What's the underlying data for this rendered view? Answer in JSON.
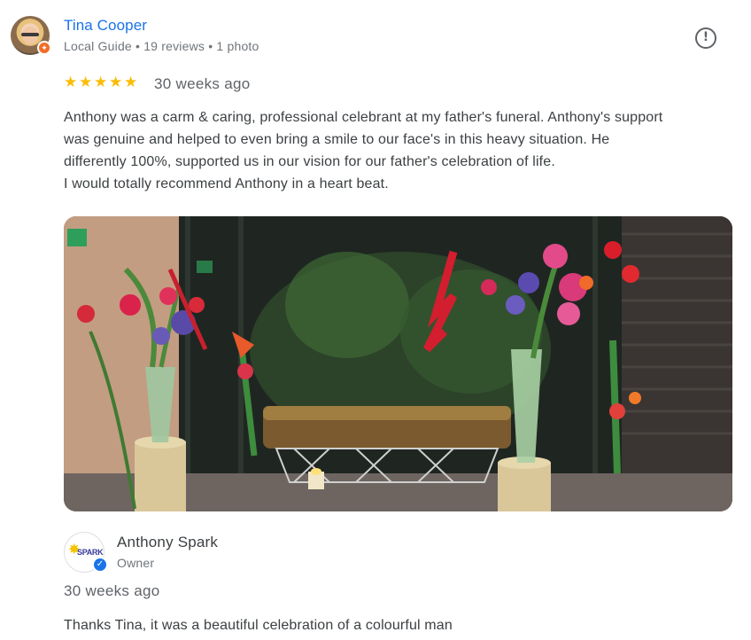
{
  "reviewer": {
    "name": "Tina Cooper",
    "meta": "Local Guide • 19 reviews • 1 photo",
    "avatar_icon": "user-photo",
    "badge_icon": "local-guide-star-icon"
  },
  "report_icon": "flag-report-icon",
  "rating": {
    "stars": 5,
    "max": 5,
    "star_glyph": "★",
    "star_color": "#fbbc04"
  },
  "review": {
    "date": "30 weeks ago",
    "lines": [
      "Anthony was a carm & caring, professional celebrant at my father's funeral. Anthony's support",
      "was genuine and helped to even bring a smile to our face's in this heavy situation. He",
      "differently 100%, supported us in our vision for our father's celebration of life.",
      "I would totally recommend Anthony in a heart beat."
    ]
  },
  "photo": {
    "subject": "funeral flower arrangements with casket"
  },
  "reply": {
    "owner_name": "Anthony Spark",
    "owner_role": "Owner",
    "logo_text": "SPARK",
    "verified_icon": "verified-check-icon",
    "date": "30 weeks ago",
    "text": "Thanks Tina, it was a beautiful celebration of a colourful man"
  },
  "colors": {
    "link_blue": "#1a73e8",
    "secondary_text": "#70757a",
    "body_text": "#3c4043"
  }
}
